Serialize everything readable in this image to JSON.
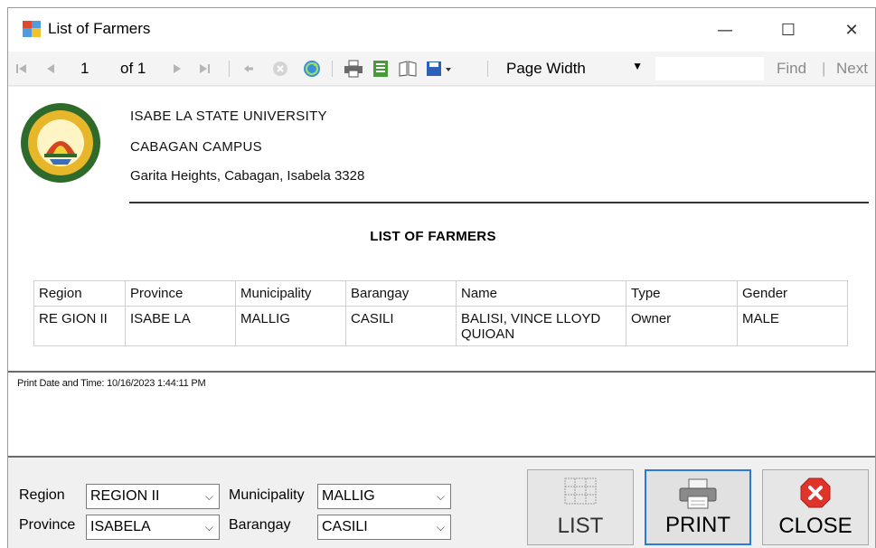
{
  "window": {
    "title": "List of Farmers",
    "controls": {
      "minimize": "—",
      "maximize": "☐",
      "close": "✕"
    }
  },
  "toolbar": {
    "current_page": "1",
    "of_label": "of",
    "total_pages": "1",
    "zoom": "Page Width",
    "find_label": "Find",
    "find_separator": "|",
    "next_label": "Next",
    "icons": [
      "first-page-icon",
      "previous-page-icon",
      "next-page-icon",
      "last-page-icon",
      "back-icon",
      "stop-icon",
      "refresh-icon",
      "print-icon",
      "print-layout-icon",
      "page-setup-icon",
      "export-icon"
    ]
  },
  "report": {
    "header": {
      "university": "ISABE LA STATE UNIVERSITY",
      "campus": "CABAGAN CAMPUS",
      "address": "Garita Heights, Cabagan, Isabela 3328"
    },
    "title": "LIST OF FARMERS",
    "columns": [
      "Region",
      "Province",
      "Municipality",
      "Barangay",
      "Name",
      "Type",
      "Gender"
    ],
    "rows": [
      [
        "RE GION II",
        "ISABE LA",
        "MALLIG",
        "CASILI",
        "BALISI, VINCE LLOYD QUIOAN",
        "Owner",
        "MALE"
      ]
    ],
    "print_date": "Print Date and Time: 10/16/2023 1:44:11 PM"
  },
  "filters": {
    "region_label": "Region",
    "region_value": "REGION II",
    "province_label": "Province",
    "province_value": "ISABELA",
    "municipality_label": "Municipality",
    "municipality_value": "MALLIG",
    "barangay_label": "Barangay",
    "barangay_value": "CASILI"
  },
  "buttons": {
    "list": "LIST",
    "print": "PRINT",
    "close": "CLOSE"
  },
  "colors": {
    "accent_border": "#2b7ad6",
    "close_icon": "#e0342a",
    "seal_green": "#2e6b2a",
    "seal_gold": "#e8b62a"
  }
}
